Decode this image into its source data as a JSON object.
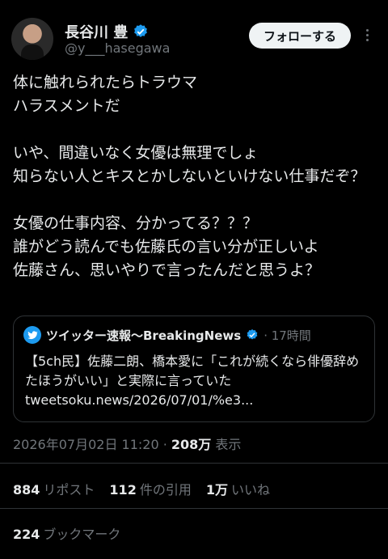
{
  "author": {
    "name": "長谷川 豊",
    "handle": "@y___hasegawa",
    "follow_label": "フォローする"
  },
  "tweet": {
    "text": "体に触れられたらトラウマ\nハラスメントだ\n\nいや、間違いなく女優は無理でしょ\n知らない人とキスとかしないといけない仕事だぞ？\n\n女優の仕事内容、分かってる？？？\n誰がどう読んでも佐藤氏の言い分が正しいよ\n佐藤さん、思いやりで言ったんだと思うよ？"
  },
  "quote": {
    "name": "ツイッター速報〜BreakingNews",
    "meta": "· 17時間",
    "text": "【5ch民】佐藤二朗、橋本愛に「これが続くなら俳優辞めたほうがいい」と実際に言っていた",
    "link": "tweetsoku.news/2026/07/01/%e3..."
  },
  "timestamp": {
    "datetime": "2026年07月02日 11:20",
    "views": "208万",
    "views_label": "表示"
  },
  "stats": {
    "reposts": "884",
    "reposts_label": "リポスト",
    "quotes": "112",
    "quotes_label": "件の引用",
    "likes": "1万",
    "likes_label": "いいね",
    "bookmarks": "224",
    "bookmarks_label": "ブックマーク"
  },
  "colors": {
    "background": "#000000",
    "verified": "#1d9bf0",
    "muted": "#71767b"
  }
}
